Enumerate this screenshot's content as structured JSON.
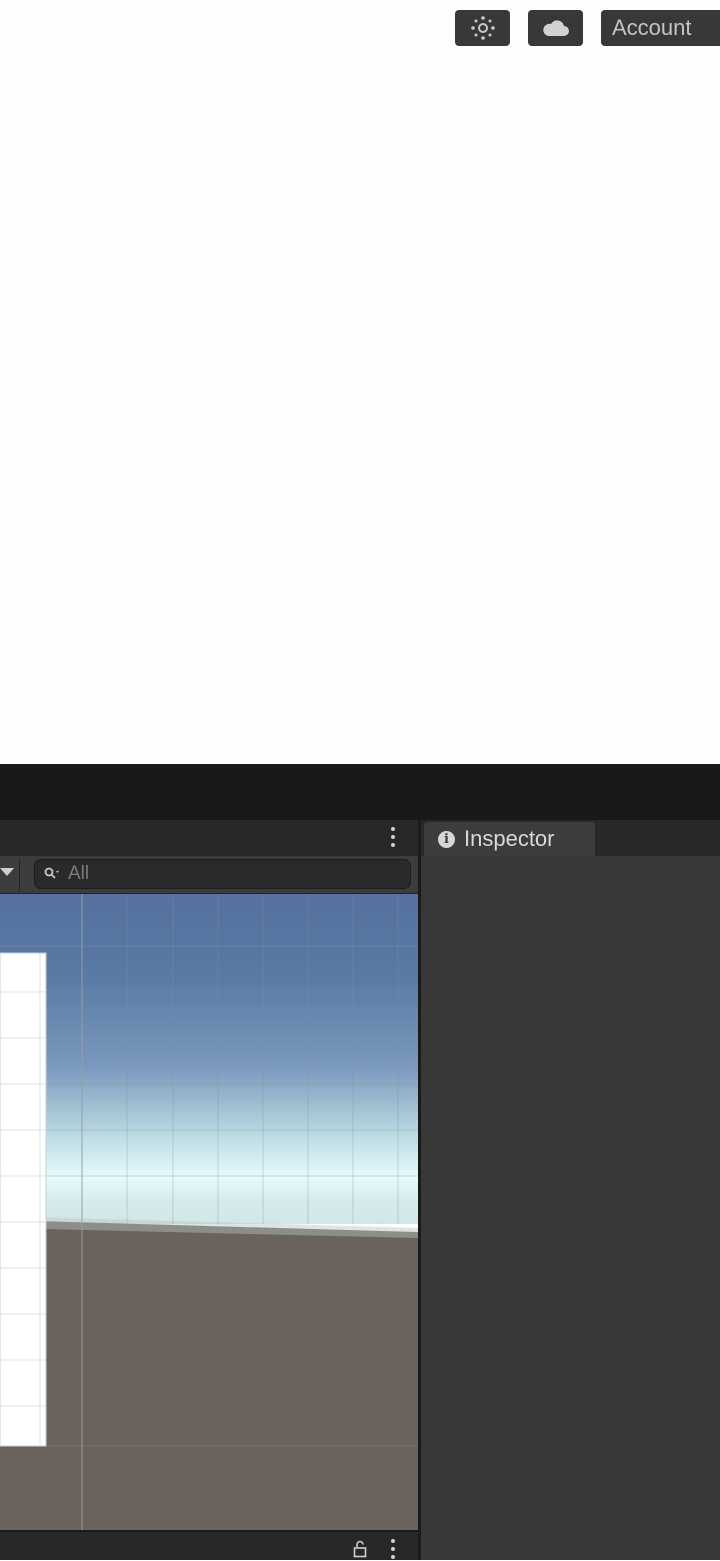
{
  "toolbar": {
    "services_icon": "sun-dots-icon",
    "cloud_icon": "cloud-icon",
    "account_label": "Account"
  },
  "scene": {
    "search_placeholder": "All",
    "menu_icon": "kebab-menu-icon",
    "lock_icon": "lock-icon"
  },
  "inspector": {
    "tab_label": "Inspector",
    "tab_icon": "info-icon"
  },
  "colors": {
    "editor_bg": "#383838",
    "toolbar_bg": "#191919",
    "sky_top": "#5673a0",
    "ground": "#6a625c"
  }
}
